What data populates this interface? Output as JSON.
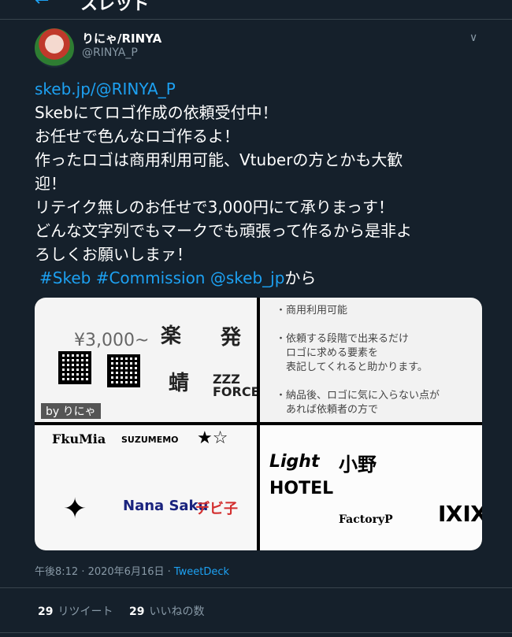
{
  "header": {
    "title": "スレッド",
    "back_icon": "arrow-left-icon"
  },
  "author": {
    "name": "りにゃ/RINYA",
    "handle": "@RINYA_P"
  },
  "tweet": {
    "link": "skeb.jp/@RINYA_P",
    "lines": [
      "Skebにてロゴ作成の依頼受付中！",
      "お任せで色んなロゴ作るよ！",
      "作ったロゴは商用利用可能、Vtuberの方とかも大歓",
      "迎！",
      "リテイク無しのお任せで3,000円にて承りまっす！",
      "どんな文字列でもマークでも頑張って作るから是非よ",
      "ろしくお願いしまァ！"
    ],
    "tag_skeb": "#Skeb",
    "tag_commission": "#Commission",
    "mention": "@skeb_jp",
    "suffix": "から"
  },
  "media": {
    "img1": {
      "price": "¥3,000~",
      "byline": "by りにゃ",
      "logo_a": "ZZZ",
      "logo_b": "FORCE"
    },
    "img2": {
      "lines": [
        "・商用利用可能",
        "・依頼する段階で出来るだけ",
        "　ロゴに求める要素を",
        "　表記してくれると助かります。",
        "・納品後、ロゴに気に入らない点が",
        "　あれば依頼者の方で"
      ]
    },
    "img3": {
      "logo_a": "FkuMia",
      "logo_b": "SUZUMEMO",
      "logo_c": "Nana Saku"
    },
    "img4": {
      "logo_a": "Light",
      "logo_b": "HOTEL",
      "logo_c": "FactoryP"
    }
  },
  "meta": {
    "time": "午後8:12 · 2020年6月16日 · ",
    "via": "TweetDeck"
  },
  "stats": {
    "retweets": "29",
    "retweets_label": "リツイート",
    "likes": "29",
    "likes_label": "いいねの数"
  }
}
